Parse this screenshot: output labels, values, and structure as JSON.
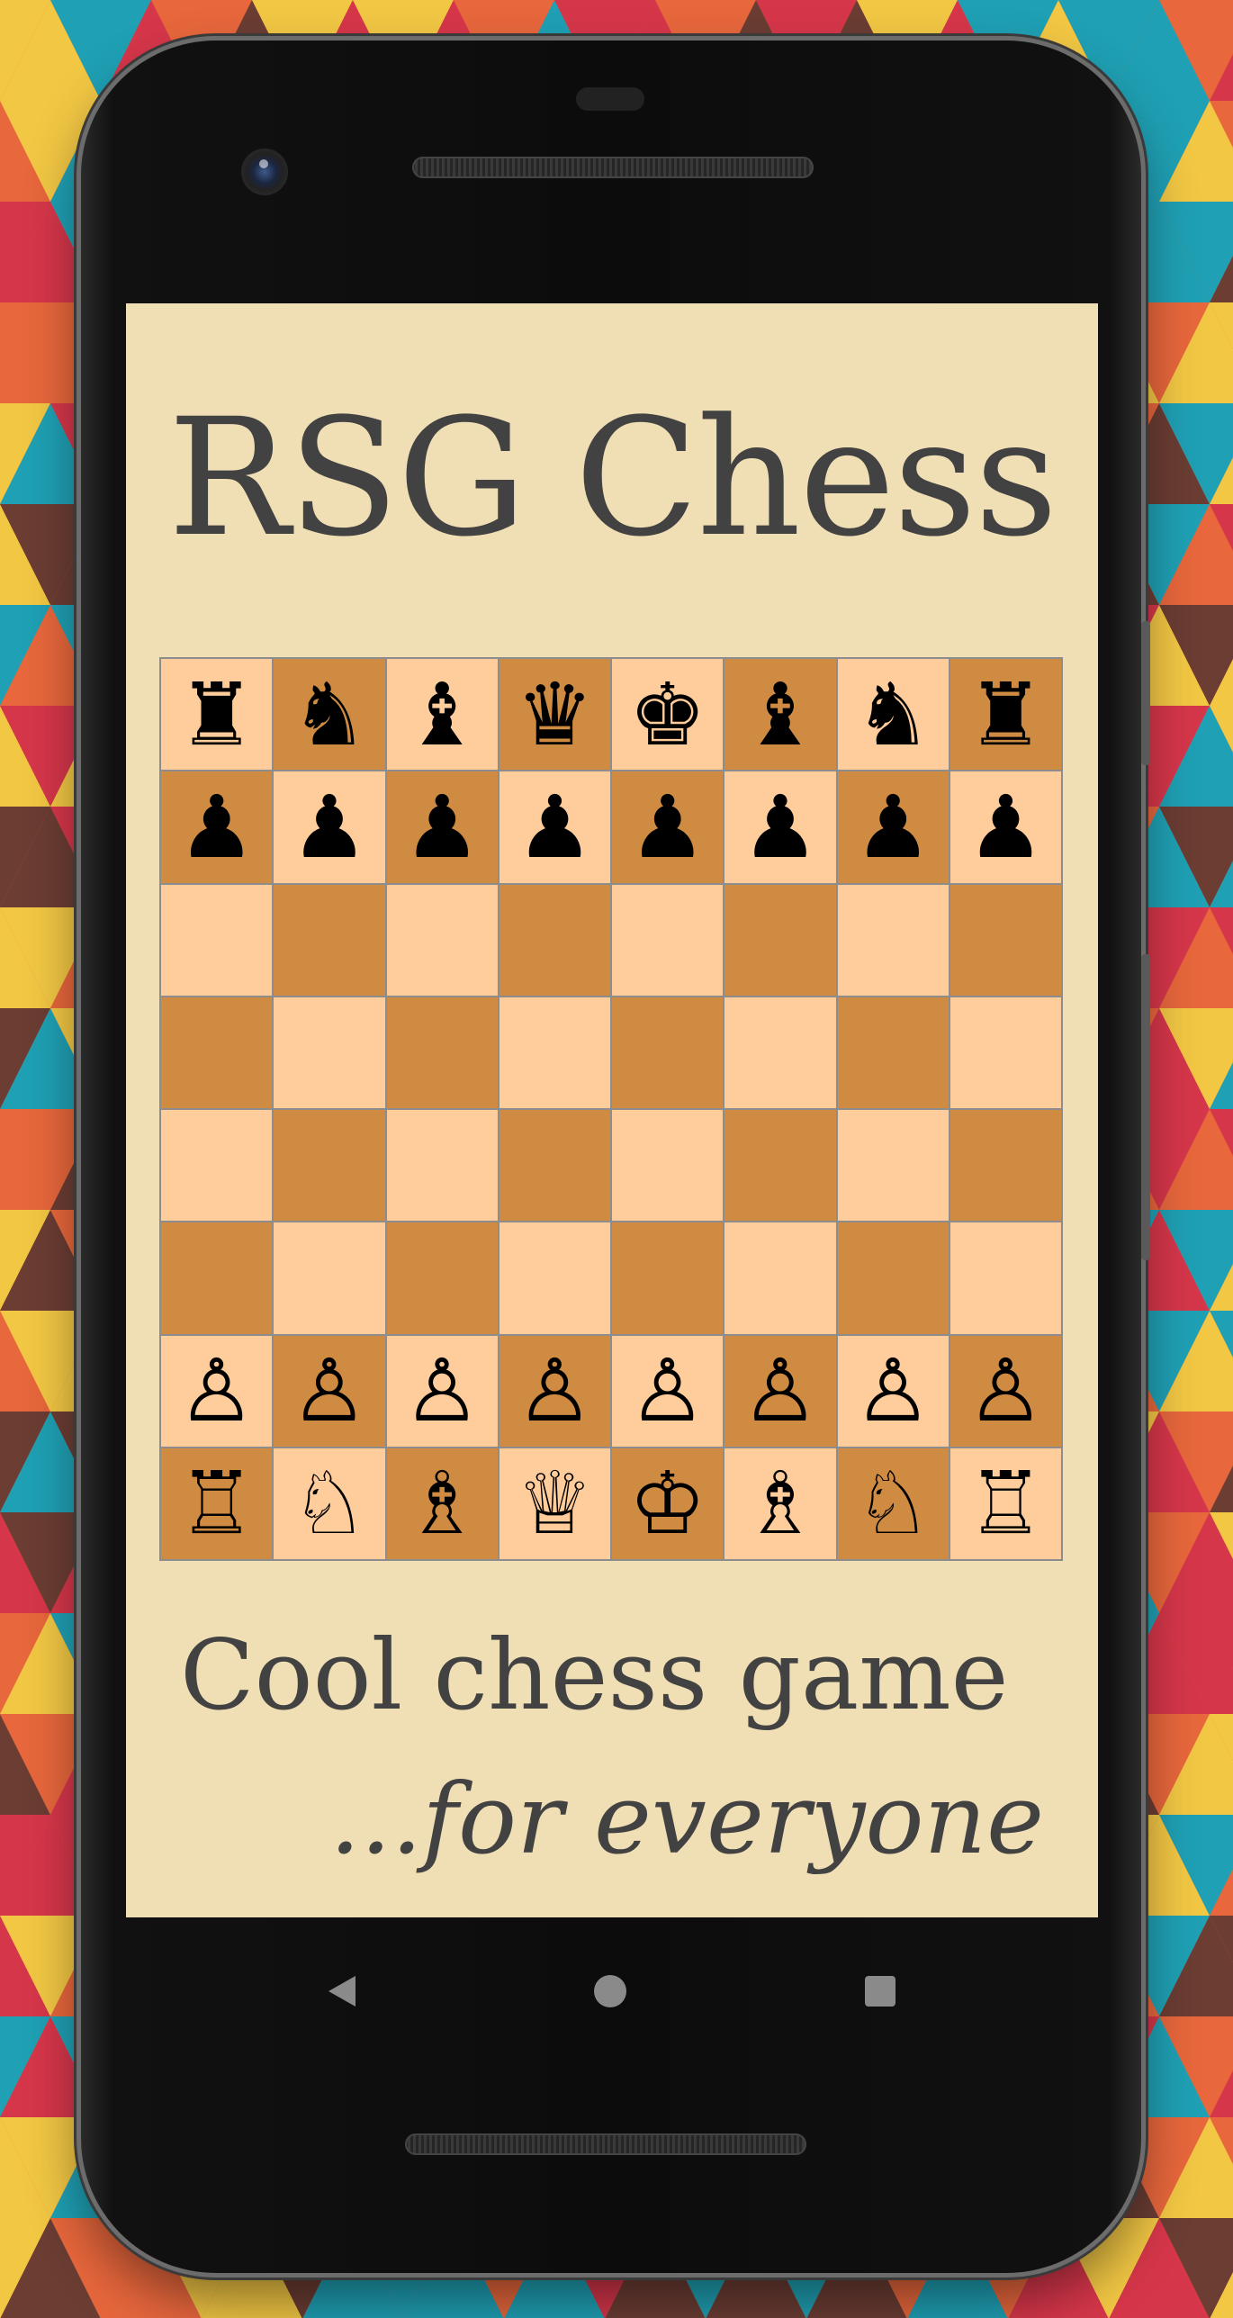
{
  "app": {
    "title": "RSG Chess",
    "tagline_line1": "Cool chess game",
    "tagline_line2": "...for everyone"
  },
  "colors": {
    "screen_background": "#f0dfb4",
    "light_square": "#ffcc9c",
    "dark_square": "#d08b43",
    "text": "#424242",
    "pattern": [
      "#e8673c",
      "#d6364a",
      "#f2c744",
      "#1fa0b4",
      "#6b3d33"
    ]
  },
  "board": {
    "ranks": [
      [
        {
          "glyph": "♜",
          "name": "black-rook"
        },
        {
          "glyph": "♞",
          "name": "black-knight"
        },
        {
          "glyph": "♝",
          "name": "black-bishop"
        },
        {
          "glyph": "♛",
          "name": "black-queen"
        },
        {
          "glyph": "♚",
          "name": "black-king"
        },
        {
          "glyph": "♝",
          "name": "black-bishop"
        },
        {
          "glyph": "♞",
          "name": "black-knight"
        },
        {
          "glyph": "♜",
          "name": "black-rook"
        }
      ],
      [
        {
          "glyph": "♟",
          "name": "black-pawn"
        },
        {
          "glyph": "♟",
          "name": "black-pawn"
        },
        {
          "glyph": "♟",
          "name": "black-pawn"
        },
        {
          "glyph": "♟",
          "name": "black-pawn"
        },
        {
          "glyph": "♟",
          "name": "black-pawn"
        },
        {
          "glyph": "♟",
          "name": "black-pawn"
        },
        {
          "glyph": "♟",
          "name": "black-pawn"
        },
        {
          "glyph": "♟",
          "name": "black-pawn"
        }
      ],
      [
        null,
        null,
        null,
        null,
        null,
        null,
        null,
        null
      ],
      [
        null,
        null,
        null,
        null,
        null,
        null,
        null,
        null
      ],
      [
        null,
        null,
        null,
        null,
        null,
        null,
        null,
        null
      ],
      [
        null,
        null,
        null,
        null,
        null,
        null,
        null,
        null
      ],
      [
        {
          "glyph": "♙",
          "name": "white-pawn"
        },
        {
          "glyph": "♙",
          "name": "white-pawn"
        },
        {
          "glyph": "♙",
          "name": "white-pawn"
        },
        {
          "glyph": "♙",
          "name": "white-pawn"
        },
        {
          "glyph": "♙",
          "name": "white-pawn"
        },
        {
          "glyph": "♙",
          "name": "white-pawn"
        },
        {
          "glyph": "♙",
          "name": "white-pawn"
        },
        {
          "glyph": "♙",
          "name": "white-pawn"
        }
      ],
      [
        {
          "glyph": "♖",
          "name": "white-rook"
        },
        {
          "glyph": "♘",
          "name": "white-knight"
        },
        {
          "glyph": "♗",
          "name": "white-bishop"
        },
        {
          "glyph": "♕",
          "name": "white-queen"
        },
        {
          "glyph": "♔",
          "name": "white-king"
        },
        {
          "glyph": "♗",
          "name": "white-bishop"
        },
        {
          "glyph": "♘",
          "name": "white-knight"
        },
        {
          "glyph": "♖",
          "name": "white-rook"
        }
      ]
    ]
  },
  "navbar": {
    "icons": [
      "back-icon",
      "home-icon",
      "recents-icon"
    ]
  }
}
